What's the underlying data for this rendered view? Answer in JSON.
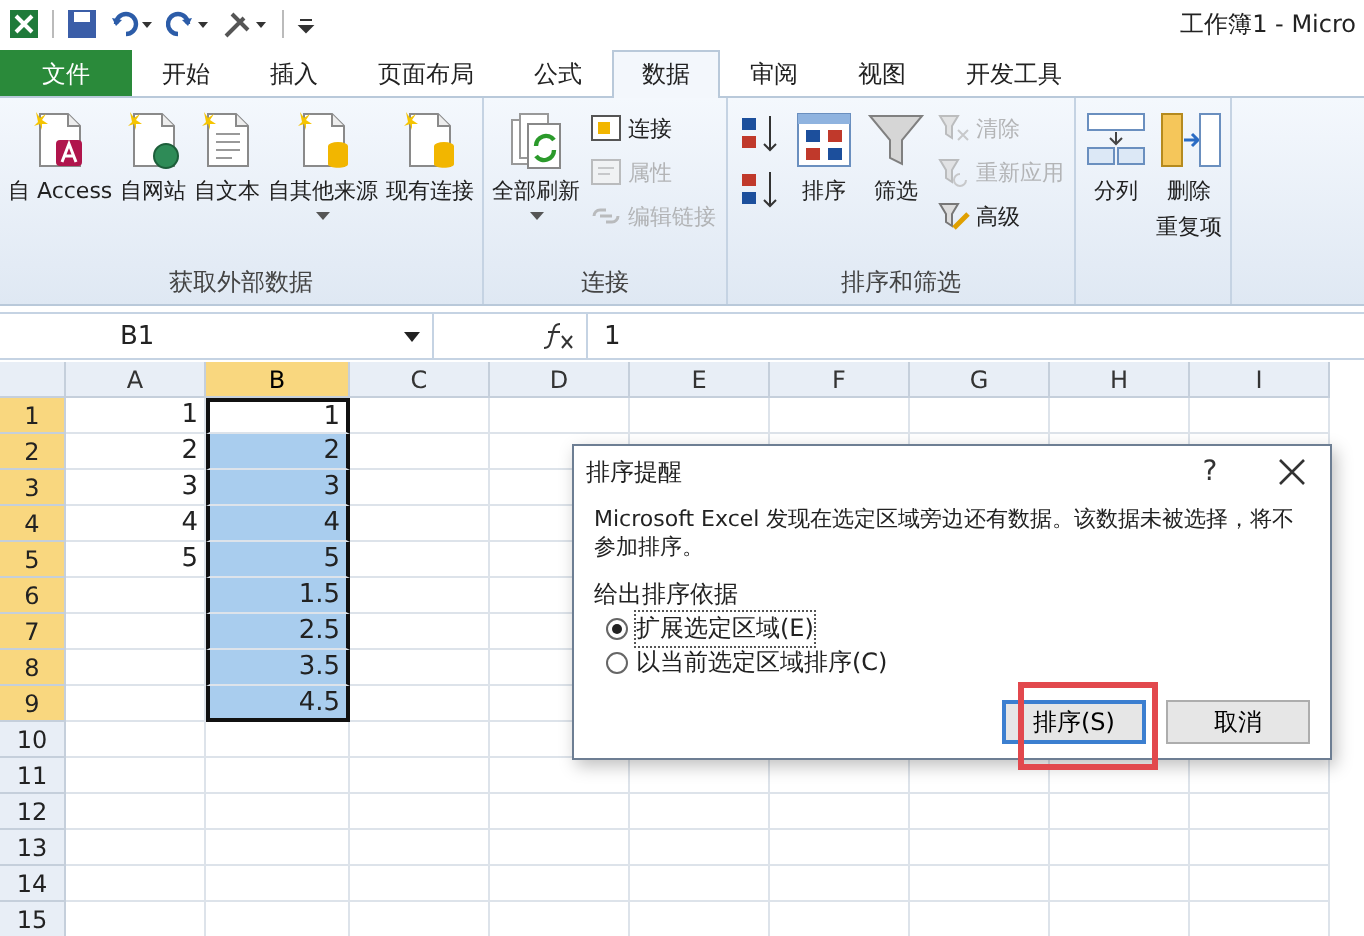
{
  "window": {
    "title": "工作簿1 - Micro"
  },
  "tabs": [
    {
      "label": "文件",
      "kind": "file",
      "selected": false
    },
    {
      "label": "开始",
      "kind": "tab",
      "selected": false
    },
    {
      "label": "插入",
      "kind": "tab",
      "selected": false
    },
    {
      "label": "页面布局",
      "kind": "tab",
      "selected": false
    },
    {
      "label": "公式",
      "kind": "tab",
      "selected": false
    },
    {
      "label": "数据",
      "kind": "tab",
      "selected": true
    },
    {
      "label": "审阅",
      "kind": "tab",
      "selected": false
    },
    {
      "label": "视图",
      "kind": "tab",
      "selected": false
    },
    {
      "label": "开发工具",
      "kind": "tab",
      "selected": false
    }
  ],
  "ribbon": {
    "groups": [
      {
        "name": "获取外部数据",
        "items": [
          {
            "kind": "large",
            "label": "自 Access",
            "caret": false
          },
          {
            "kind": "large",
            "label": "自网站",
            "caret": false
          },
          {
            "kind": "large",
            "label": "自文本",
            "caret": false
          },
          {
            "kind": "large",
            "label": "自其他来源",
            "caret": true
          },
          {
            "kind": "large",
            "label": "现有连接",
            "caret": false
          }
        ]
      },
      {
        "name": "连接",
        "items": [
          {
            "kind": "large",
            "label": "全部刷新",
            "caret": true
          },
          {
            "kind": "stack",
            "entries": [
              {
                "label": "连接",
                "disabled": false
              },
              {
                "label": "属性",
                "disabled": true
              },
              {
                "label": "编辑链接",
                "disabled": true
              }
            ]
          }
        ]
      },
      {
        "name": "排序和筛选",
        "items": [
          {
            "kind": "stack",
            "entries": [
              {
                "disabled": false
              },
              {
                "disabled": false
              }
            ]
          },
          {
            "kind": "large",
            "label": "排序",
            "caret": false
          },
          {
            "kind": "large",
            "label": "筛选",
            "caret": false
          },
          {
            "kind": "stack",
            "entries": [
              {
                "label": "清除",
                "disabled": true
              },
              {
                "label": "重新应用",
                "disabled": true
              },
              {
                "label": "高级",
                "disabled": false
              }
            ]
          }
        ]
      },
      {
        "items": [
          {
            "kind": "large",
            "label": "分列",
            "caret": false
          },
          {
            "kind": "large",
            "label": "删除",
            "label2": "重复项",
            "caret": false
          }
        ]
      }
    ]
  },
  "formula_bar": {
    "name_box": "B1",
    "value": "1"
  },
  "sheet": {
    "columns": [
      {
        "label": "A",
        "selected": false
      },
      {
        "label": "B",
        "selected": true
      },
      {
        "label": "C",
        "selected": false
      },
      {
        "label": "D",
        "selected": false
      },
      {
        "label": "E",
        "selected": false
      },
      {
        "label": "F",
        "selected": false
      },
      {
        "label": "G",
        "selected": false
      },
      {
        "label": "H",
        "selected": false
      },
      {
        "label": "I",
        "selected": false
      }
    ],
    "rows": [
      {
        "label": "1",
        "selected": true,
        "active": true,
        "cells": [
          "1",
          "1"
        ]
      },
      {
        "label": "2",
        "selected": true,
        "active": false,
        "cells": [
          "2",
          "2"
        ]
      },
      {
        "label": "3",
        "selected": true,
        "active": false,
        "cells": [
          "3",
          "3"
        ]
      },
      {
        "label": "4",
        "selected": true,
        "active": false,
        "cells": [
          "4",
          "4"
        ]
      },
      {
        "label": "5",
        "selected": true,
        "active": false,
        "cells": [
          "5",
          "5"
        ]
      },
      {
        "label": "6",
        "selected": true,
        "active": false,
        "cells": [
          "",
          "1.5"
        ]
      },
      {
        "label": "7",
        "selected": true,
        "active": false,
        "cells": [
          "",
          "2.5"
        ]
      },
      {
        "label": "8",
        "selected": true,
        "active": false,
        "cells": [
          "",
          "3.5"
        ]
      },
      {
        "label": "9",
        "selected": true,
        "active": false,
        "cells": [
          "",
          "4.5"
        ]
      },
      {
        "label": "10",
        "selected": false,
        "active": false,
        "cells": []
      },
      {
        "label": "11",
        "selected": false,
        "active": false,
        "cells": []
      },
      {
        "label": "12",
        "selected": false,
        "active": false,
        "cells": []
      },
      {
        "label": "13",
        "selected": false,
        "active": false,
        "cells": []
      },
      {
        "label": "14",
        "selected": false,
        "active": false,
        "cells": []
      },
      {
        "label": "15",
        "selected": false,
        "active": false,
        "cells": []
      }
    ]
  },
  "dialog": {
    "title": "排序提醒",
    "help": "?",
    "message": "Microsoft Excel 发现在选定区域旁边还有数据。该数据未被选择，将不参加排序。",
    "group_label": "给出排序依据",
    "options": [
      {
        "label": "扩展选定区域(E)",
        "selected": true
      },
      {
        "label": "以当前选定区域排序(C)",
        "selected": false
      }
    ],
    "buttons": [
      {
        "label": "排序(S)",
        "default": true
      },
      {
        "label": "取消",
        "default": false
      }
    ]
  }
}
